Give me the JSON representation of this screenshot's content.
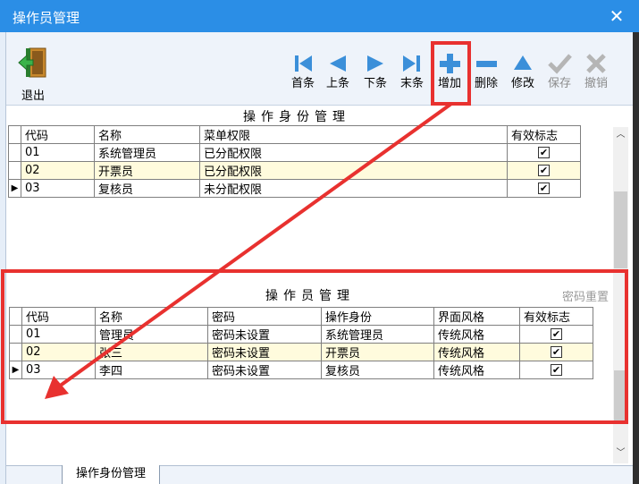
{
  "window": {
    "title": "操作员管理",
    "close_glyph": "✕"
  },
  "toolbar": {
    "exit_label": "退出",
    "buttons": [
      {
        "key": "first",
        "label": "首条",
        "icon": "first-record-icon",
        "enabled": true
      },
      {
        "key": "prev",
        "label": "上条",
        "icon": "previous-record-icon",
        "enabled": true
      },
      {
        "key": "next",
        "label": "下条",
        "icon": "next-record-icon",
        "enabled": true
      },
      {
        "key": "last",
        "label": "末条",
        "icon": "last-record-icon",
        "enabled": true
      },
      {
        "key": "add",
        "label": "增加",
        "icon": "plus-icon",
        "enabled": true
      },
      {
        "key": "delete",
        "label": "删除",
        "icon": "minus-icon",
        "enabled": true
      },
      {
        "key": "edit",
        "label": "修改",
        "icon": "edit-triangle-icon",
        "enabled": true
      },
      {
        "key": "save",
        "label": "保存",
        "icon": "checkmark-icon",
        "enabled": false
      },
      {
        "key": "cancel",
        "label": "撤销",
        "icon": "x-icon",
        "enabled": false
      }
    ],
    "accent_color": "#2b8ee6"
  },
  "identity_grid": {
    "title": "操作身份管理",
    "columns": [
      "代码",
      "名称",
      "菜单权限",
      "有效标志"
    ],
    "rows": [
      {
        "code": "01",
        "name": "系统管理员",
        "perm": "已分配权限",
        "valid": true,
        "current": false
      },
      {
        "code": "02",
        "name": "开票员",
        "perm": "已分配权限",
        "valid": true,
        "current": false
      },
      {
        "code": "03",
        "name": "复核员",
        "perm": "未分配权限",
        "valid": true,
        "current": true
      }
    ]
  },
  "operator_grid": {
    "title": "操作员管理",
    "reset_password_label": "密码重置",
    "columns": [
      "代码",
      "名称",
      "密码",
      "操作身份",
      "界面风格",
      "有效标志"
    ],
    "rows": [
      {
        "code": "01",
        "name": "管理员",
        "pwd": "密码未设置",
        "role": "系统管理员",
        "style": "传统风格",
        "valid": true,
        "current": false
      },
      {
        "code": "02",
        "name": "张三",
        "pwd": "密码未设置",
        "role": "开票员",
        "style": "传统风格",
        "valid": true,
        "current": false
      },
      {
        "code": "03",
        "name": "李四",
        "pwd": "密码未设置",
        "role": "复核员",
        "style": "传统风格",
        "valid": true,
        "current": true
      }
    ]
  },
  "bottom_tab": {
    "label": "操作身份管理"
  },
  "annotation": {
    "color": "#e8312f"
  }
}
